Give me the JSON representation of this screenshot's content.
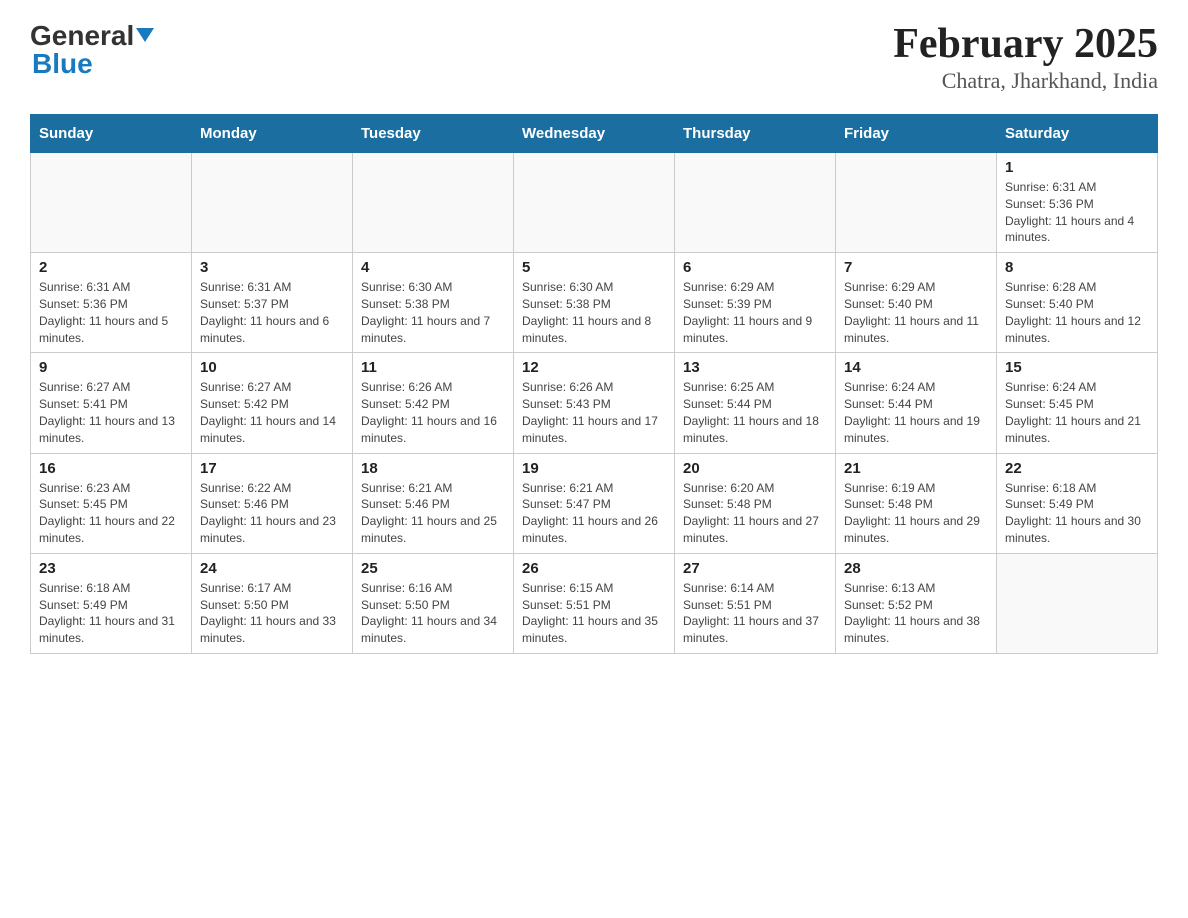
{
  "header": {
    "logo_general": "General",
    "logo_blue": "Blue",
    "title": "February 2025",
    "subtitle": "Chatra, Jharkhand, India"
  },
  "weekdays": [
    "Sunday",
    "Monday",
    "Tuesday",
    "Wednesday",
    "Thursday",
    "Friday",
    "Saturday"
  ],
  "weeks": [
    [
      {
        "day": "",
        "sunrise": "",
        "sunset": "",
        "daylight": ""
      },
      {
        "day": "",
        "sunrise": "",
        "sunset": "",
        "daylight": ""
      },
      {
        "day": "",
        "sunrise": "",
        "sunset": "",
        "daylight": ""
      },
      {
        "day": "",
        "sunrise": "",
        "sunset": "",
        "daylight": ""
      },
      {
        "day": "",
        "sunrise": "",
        "sunset": "",
        "daylight": ""
      },
      {
        "day": "",
        "sunrise": "",
        "sunset": "",
        "daylight": ""
      },
      {
        "day": "1",
        "sunrise": "Sunrise: 6:31 AM",
        "sunset": "Sunset: 5:36 PM",
        "daylight": "Daylight: 11 hours and 4 minutes."
      }
    ],
    [
      {
        "day": "2",
        "sunrise": "Sunrise: 6:31 AM",
        "sunset": "Sunset: 5:36 PM",
        "daylight": "Daylight: 11 hours and 5 minutes."
      },
      {
        "day": "3",
        "sunrise": "Sunrise: 6:31 AM",
        "sunset": "Sunset: 5:37 PM",
        "daylight": "Daylight: 11 hours and 6 minutes."
      },
      {
        "day": "4",
        "sunrise": "Sunrise: 6:30 AM",
        "sunset": "Sunset: 5:38 PM",
        "daylight": "Daylight: 11 hours and 7 minutes."
      },
      {
        "day": "5",
        "sunrise": "Sunrise: 6:30 AM",
        "sunset": "Sunset: 5:38 PM",
        "daylight": "Daylight: 11 hours and 8 minutes."
      },
      {
        "day": "6",
        "sunrise": "Sunrise: 6:29 AM",
        "sunset": "Sunset: 5:39 PM",
        "daylight": "Daylight: 11 hours and 9 minutes."
      },
      {
        "day": "7",
        "sunrise": "Sunrise: 6:29 AM",
        "sunset": "Sunset: 5:40 PM",
        "daylight": "Daylight: 11 hours and 11 minutes."
      },
      {
        "day": "8",
        "sunrise": "Sunrise: 6:28 AM",
        "sunset": "Sunset: 5:40 PM",
        "daylight": "Daylight: 11 hours and 12 minutes."
      }
    ],
    [
      {
        "day": "9",
        "sunrise": "Sunrise: 6:27 AM",
        "sunset": "Sunset: 5:41 PM",
        "daylight": "Daylight: 11 hours and 13 minutes."
      },
      {
        "day": "10",
        "sunrise": "Sunrise: 6:27 AM",
        "sunset": "Sunset: 5:42 PM",
        "daylight": "Daylight: 11 hours and 14 minutes."
      },
      {
        "day": "11",
        "sunrise": "Sunrise: 6:26 AM",
        "sunset": "Sunset: 5:42 PM",
        "daylight": "Daylight: 11 hours and 16 minutes."
      },
      {
        "day": "12",
        "sunrise": "Sunrise: 6:26 AM",
        "sunset": "Sunset: 5:43 PM",
        "daylight": "Daylight: 11 hours and 17 minutes."
      },
      {
        "day": "13",
        "sunrise": "Sunrise: 6:25 AM",
        "sunset": "Sunset: 5:44 PM",
        "daylight": "Daylight: 11 hours and 18 minutes."
      },
      {
        "day": "14",
        "sunrise": "Sunrise: 6:24 AM",
        "sunset": "Sunset: 5:44 PM",
        "daylight": "Daylight: 11 hours and 19 minutes."
      },
      {
        "day": "15",
        "sunrise": "Sunrise: 6:24 AM",
        "sunset": "Sunset: 5:45 PM",
        "daylight": "Daylight: 11 hours and 21 minutes."
      }
    ],
    [
      {
        "day": "16",
        "sunrise": "Sunrise: 6:23 AM",
        "sunset": "Sunset: 5:45 PM",
        "daylight": "Daylight: 11 hours and 22 minutes."
      },
      {
        "day": "17",
        "sunrise": "Sunrise: 6:22 AM",
        "sunset": "Sunset: 5:46 PM",
        "daylight": "Daylight: 11 hours and 23 minutes."
      },
      {
        "day": "18",
        "sunrise": "Sunrise: 6:21 AM",
        "sunset": "Sunset: 5:46 PM",
        "daylight": "Daylight: 11 hours and 25 minutes."
      },
      {
        "day": "19",
        "sunrise": "Sunrise: 6:21 AM",
        "sunset": "Sunset: 5:47 PM",
        "daylight": "Daylight: 11 hours and 26 minutes."
      },
      {
        "day": "20",
        "sunrise": "Sunrise: 6:20 AM",
        "sunset": "Sunset: 5:48 PM",
        "daylight": "Daylight: 11 hours and 27 minutes."
      },
      {
        "day": "21",
        "sunrise": "Sunrise: 6:19 AM",
        "sunset": "Sunset: 5:48 PM",
        "daylight": "Daylight: 11 hours and 29 minutes."
      },
      {
        "day": "22",
        "sunrise": "Sunrise: 6:18 AM",
        "sunset": "Sunset: 5:49 PM",
        "daylight": "Daylight: 11 hours and 30 minutes."
      }
    ],
    [
      {
        "day": "23",
        "sunrise": "Sunrise: 6:18 AM",
        "sunset": "Sunset: 5:49 PM",
        "daylight": "Daylight: 11 hours and 31 minutes."
      },
      {
        "day": "24",
        "sunrise": "Sunrise: 6:17 AM",
        "sunset": "Sunset: 5:50 PM",
        "daylight": "Daylight: 11 hours and 33 minutes."
      },
      {
        "day": "25",
        "sunrise": "Sunrise: 6:16 AM",
        "sunset": "Sunset: 5:50 PM",
        "daylight": "Daylight: 11 hours and 34 minutes."
      },
      {
        "day": "26",
        "sunrise": "Sunrise: 6:15 AM",
        "sunset": "Sunset: 5:51 PM",
        "daylight": "Daylight: 11 hours and 35 minutes."
      },
      {
        "day": "27",
        "sunrise": "Sunrise: 6:14 AM",
        "sunset": "Sunset: 5:51 PM",
        "daylight": "Daylight: 11 hours and 37 minutes."
      },
      {
        "day": "28",
        "sunrise": "Sunrise: 6:13 AM",
        "sunset": "Sunset: 5:52 PM",
        "daylight": "Daylight: 11 hours and 38 minutes."
      },
      {
        "day": "",
        "sunrise": "",
        "sunset": "",
        "daylight": ""
      }
    ]
  ]
}
